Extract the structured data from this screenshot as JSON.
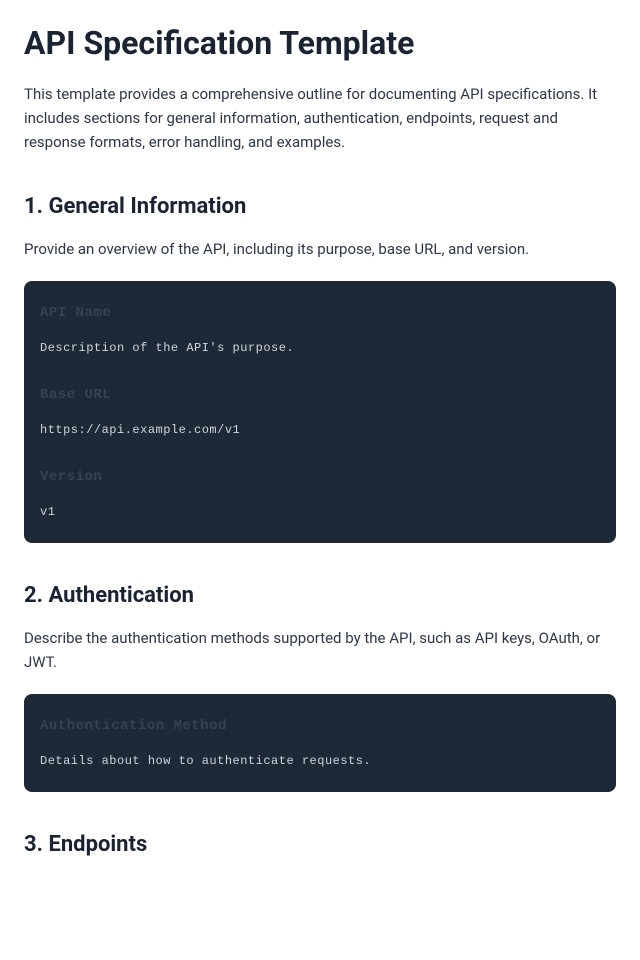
{
  "title": "API Specification Template",
  "intro": "This template provides a comprehensive outline for documenting API specifications. It includes sections for general information, authentication, endpoints, request and response formats, error handling, and examples.",
  "sections": {
    "general": {
      "heading": "1. General Information",
      "description": "Provide an overview of the API, including its purpose, base URL, and version.",
      "blocks": [
        {
          "label": "API Name",
          "value": "Description of the API's purpose."
        },
        {
          "label": "Base URL",
          "value": "https://api.example.com/v1"
        },
        {
          "label": "Version",
          "value": "v1"
        }
      ]
    },
    "auth": {
      "heading": "2. Authentication",
      "description": "Describe the authentication methods supported by the API, such as API keys, OAuth, or JWT.",
      "blocks": [
        {
          "label": "Authentication Method",
          "value": "Details about how to authenticate requests."
        }
      ]
    },
    "endpoints": {
      "heading": "3. Endpoints"
    }
  }
}
